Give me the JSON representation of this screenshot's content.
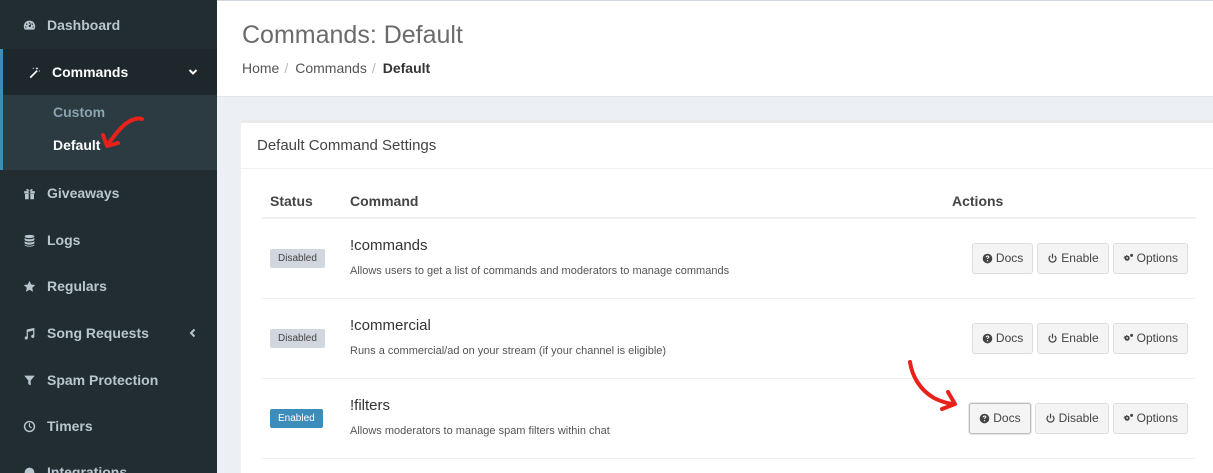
{
  "sidebar": {
    "items": [
      {
        "label": "Dashboard",
        "icon": "dashboard-icon"
      },
      {
        "label": "Commands",
        "icon": "magic-wand-icon"
      },
      {
        "label": "Giveaways",
        "icon": "gift-icon"
      },
      {
        "label": "Logs",
        "icon": "database-icon"
      },
      {
        "label": "Regulars",
        "icon": "star-icon"
      },
      {
        "label": "Song Requests",
        "icon": "music-icon"
      },
      {
        "label": "Spam Protection",
        "icon": "filter-icon"
      },
      {
        "label": "Timers",
        "icon": "clock-icon"
      },
      {
        "label": "Integrations",
        "icon": "integrations-icon"
      }
    ],
    "submenu": [
      "Custom",
      "Default"
    ]
  },
  "header": {
    "title": "Commands: Default",
    "breadcrumb": [
      "Home",
      "Commands",
      "Default"
    ]
  },
  "box": {
    "title": "Default Command Settings",
    "columns": {
      "status": "Status",
      "command": "Command",
      "actions": "Actions"
    },
    "rows": [
      {
        "status": "Disabled",
        "name": "!commands",
        "desc": "Allows users to get a list of commands and moderators to manage commands",
        "toggle": "Enable"
      },
      {
        "status": "Disabled",
        "name": "!commercial",
        "desc": "Runs a commercial/ad on your stream (if your channel is eligible)",
        "toggle": "Enable"
      },
      {
        "status": "Enabled",
        "name": "!filters",
        "desc": "Allows moderators to manage spam filters within chat",
        "toggle": "Disable"
      }
    ],
    "docs_label": "Docs",
    "options_label": "Options"
  },
  "colors": {
    "sidebar_bg": "#222d32",
    "accent": "#3c8dbc",
    "annotation": "#e8211b"
  }
}
